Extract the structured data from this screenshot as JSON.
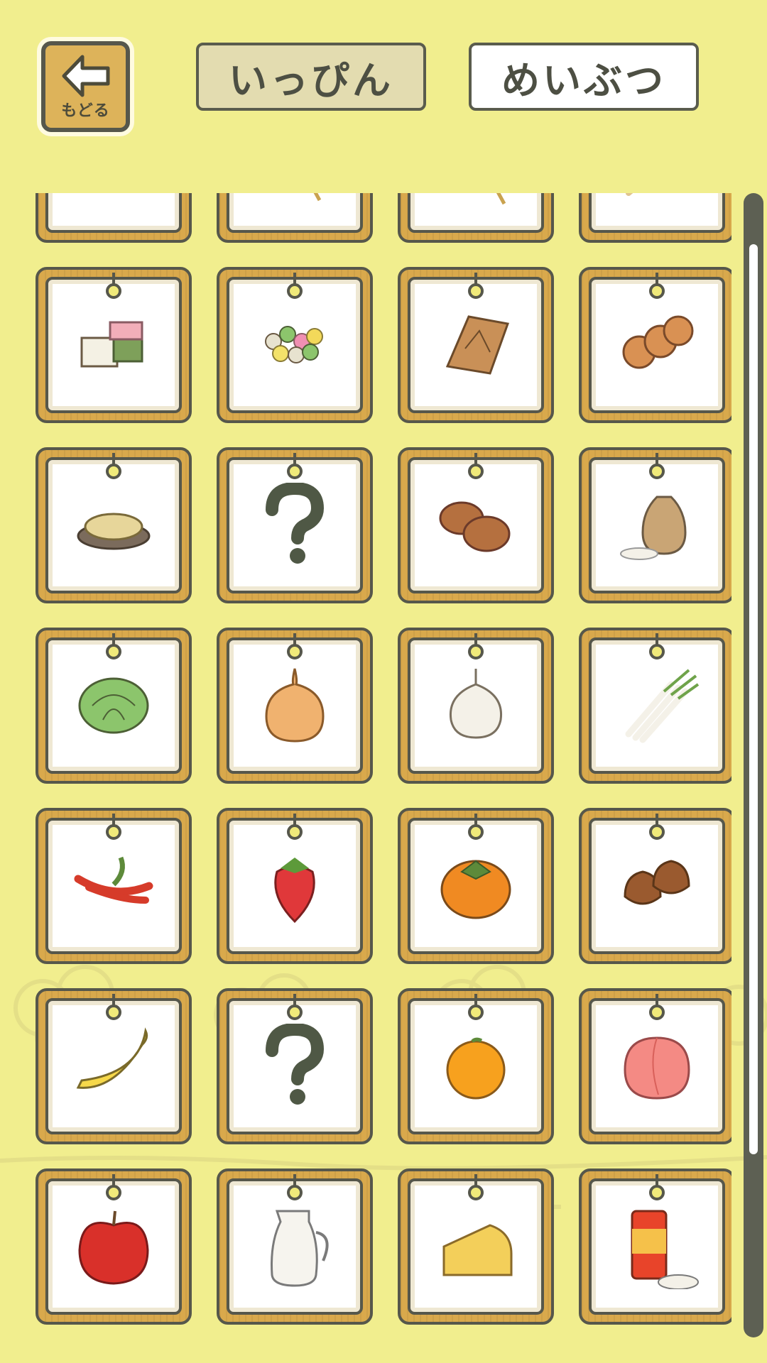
{
  "header": {
    "back_label": "もどる",
    "tabs": [
      {
        "label": "いっぴん",
        "selected": true
      },
      {
        "label": "めいぶつ",
        "selected": false
      }
    ]
  },
  "collection": {
    "items": [
      {
        "icon": "senbei-crackers-icon"
      },
      {
        "icon": "skewer-stick-icon"
      },
      {
        "icon": "dango-skewer-icon"
      },
      {
        "icon": "grilled-skewer-icon"
      },
      {
        "icon": "yokan-sweets-icon"
      },
      {
        "icon": "colorful-candy-balls-icon"
      },
      {
        "icon": "yatsuhashi-pastry-icon"
      },
      {
        "icon": "round-buns-icon"
      },
      {
        "icon": "fried-snack-plate-icon"
      },
      {
        "icon": "question-mark-icon"
      },
      {
        "icon": "manju-buns-icon"
      },
      {
        "icon": "rice-sack-icon"
      },
      {
        "icon": "cabbage-icon"
      },
      {
        "icon": "onion-icon"
      },
      {
        "icon": "garlic-icon"
      },
      {
        "icon": "green-onion-icon"
      },
      {
        "icon": "chili-pepper-icon"
      },
      {
        "icon": "strawberry-icon"
      },
      {
        "icon": "persimmon-icon"
      },
      {
        "icon": "chestnut-icon"
      },
      {
        "icon": "banana-icon"
      },
      {
        "icon": "question-mark-icon"
      },
      {
        "icon": "mandarin-orange-icon"
      },
      {
        "icon": "peach-icon"
      },
      {
        "icon": "apple-icon"
      },
      {
        "icon": "milk-pitcher-icon"
      },
      {
        "icon": "cheese-icon"
      },
      {
        "icon": "tea-canister-icon"
      }
    ]
  },
  "scrollbar": {
    "position": 0.02
  }
}
